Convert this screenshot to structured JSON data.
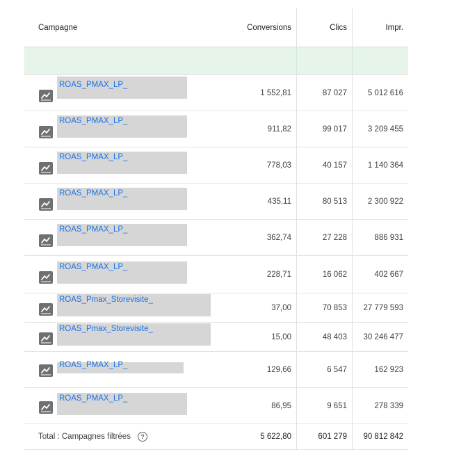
{
  "headers": {
    "campaign": "Campagne",
    "conversions": "Conversions",
    "clicks": "Clics",
    "impressions": "Impr."
  },
  "rows": [
    {
      "name": "ROAS_PMAX_LP_",
      "conversions": "1 552,81",
      "clicks": "87 027",
      "impressions": "5 012 616"
    },
    {
      "name": "ROAS_PMAX_LP_",
      "conversions": "911,82",
      "clicks": "99 017",
      "impressions": "3 209 455"
    },
    {
      "name": "ROAS_PMAX_LP_",
      "conversions": "778,03",
      "clicks": "40 157",
      "impressions": "1 140 364"
    },
    {
      "name": "ROAS_PMAX_LP_",
      "conversions": "435,11",
      "clicks": "80 513",
      "impressions": "2 300 922"
    },
    {
      "name": "ROAS_PMAX_LP_",
      "conversions": "362,74",
      "clicks": "27 228",
      "impressions": "886 931"
    },
    {
      "name": "ROAS_PMAX_LP_",
      "conversions": "228,71",
      "clicks": "16 062",
      "impressions": "402 667"
    },
    {
      "name": "ROAS_Pmax_Storevisite_",
      "conversions": "37,00",
      "clicks": "70 853",
      "impressions": "27 779 593"
    },
    {
      "name": "ROAS_Pmax_Storevisite_",
      "conversions": "15,00",
      "clicks": "48 403",
      "impressions": "30 246 477"
    },
    {
      "name": "ROAS_PMAX_LP_",
      "conversions": "129,66",
      "clicks": "6 547",
      "impressions": "162 923"
    },
    {
      "name": "ROAS_PMAX_LP_",
      "conversions": "86,95",
      "clicks": "9 651",
      "impressions": "278 339"
    }
  ],
  "total": {
    "label": "Total : Campagnes filtrées",
    "help_icon": "?",
    "conversions": "5 622,80",
    "clicks": "601 279",
    "impressions": "90 812 842"
  },
  "icons": {
    "campaign": "trend-chart-icon",
    "help": "help-circle-icon"
  },
  "colors": {
    "link": "#1a73e8",
    "highlight_row": "#e6f4ea",
    "icon": "#6e7174",
    "redaction": "#d6d6d6"
  }
}
